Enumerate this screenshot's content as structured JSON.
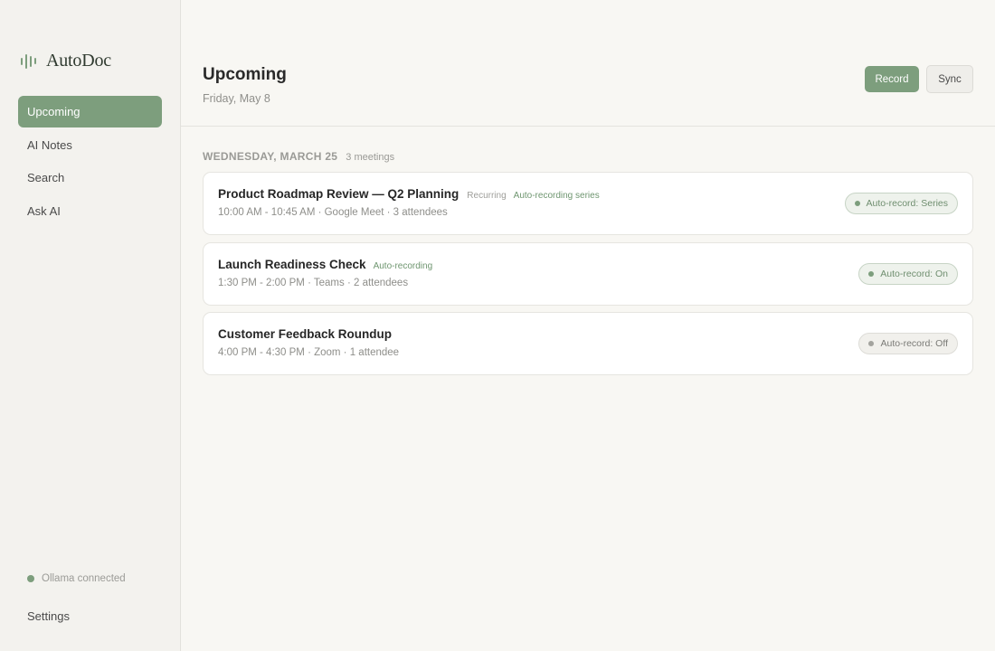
{
  "app": {
    "name": "AutoDoc"
  },
  "colors": {
    "accent": "#7d9e7d",
    "background": "#f8f7f3",
    "sidebar": "#f3f2ee"
  },
  "sidebar": {
    "items": [
      {
        "label": "Upcoming",
        "active": true
      },
      {
        "label": "AI Notes"
      },
      {
        "label": "Search"
      },
      {
        "label": "Ask AI"
      }
    ],
    "status": "Ollama connected",
    "settings": "Settings"
  },
  "header": {
    "title": "Upcoming",
    "subtitle": "Friday, May 8",
    "record_label": "Record",
    "sync_label": "Sync"
  },
  "day": {
    "label": "WEDNESDAY, MARCH 25",
    "count": "3 meetings"
  },
  "meetings": [
    {
      "title": "Product Roadmap Review — Q2 Planning",
      "recurring_tag": "Recurring",
      "auto_tag": "Auto-recording series",
      "meta": "10:00 AM - 10:45 AM · Google Meet · 3 attendees",
      "pill": "Auto-record: Series",
      "pill_state": "on"
    },
    {
      "title": "Launch Readiness Check",
      "auto_tag": "Auto-recording",
      "meta": "1:30 PM - 2:00 PM · Teams · 2 attendees",
      "pill": "Auto-record: On",
      "pill_state": "on"
    },
    {
      "title": "Customer Feedback Roundup",
      "meta": "4:00 PM - 4:30 PM · Zoom · 1 attendee",
      "pill": "Auto-record: Off",
      "pill_state": "off"
    }
  ]
}
